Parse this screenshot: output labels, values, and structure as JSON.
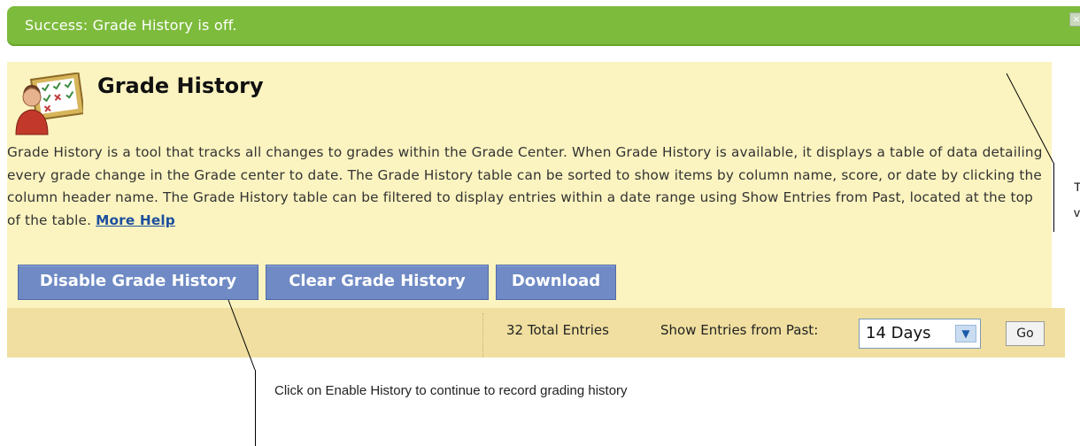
{
  "success": {
    "message": "Success: Grade History is off.",
    "close_glyph": "×"
  },
  "header": {
    "title": "Grade History",
    "icon": "gradebook-icon"
  },
  "description": {
    "text": "Grade History is a tool that tracks all changes to grades within the Grade Center. When Grade History is available, it displays a table of data detailing every grade change in the Grade center to date. The Grade History table can be sorted to show items by column name, score, or date by clicking the column header name. The Grade History table can be filtered to display entries within a date range using Show Entries from Past, located at the top of the table. ",
    "more_help": "More Help"
  },
  "actions": {
    "disable": "Disable Grade History",
    "clear": "Clear Grade History",
    "download": "Download"
  },
  "toolbar": {
    "total_entries": "32 Total Entries",
    "show_label": "Show Entries from Past:",
    "range_value": "14 Days",
    "go": "Go"
  },
  "annotations": {
    "bottom_note": "Click on Enable History to continue to record grading history",
    "cut_text_1": "T",
    "cut_text_2": "v"
  },
  "colors": {
    "success_green": "#7dbb3c",
    "panel_yellow": "#fcf4c0",
    "button_blue": "#6f8ac4",
    "toolbar_tan": "#f0dfa0"
  }
}
